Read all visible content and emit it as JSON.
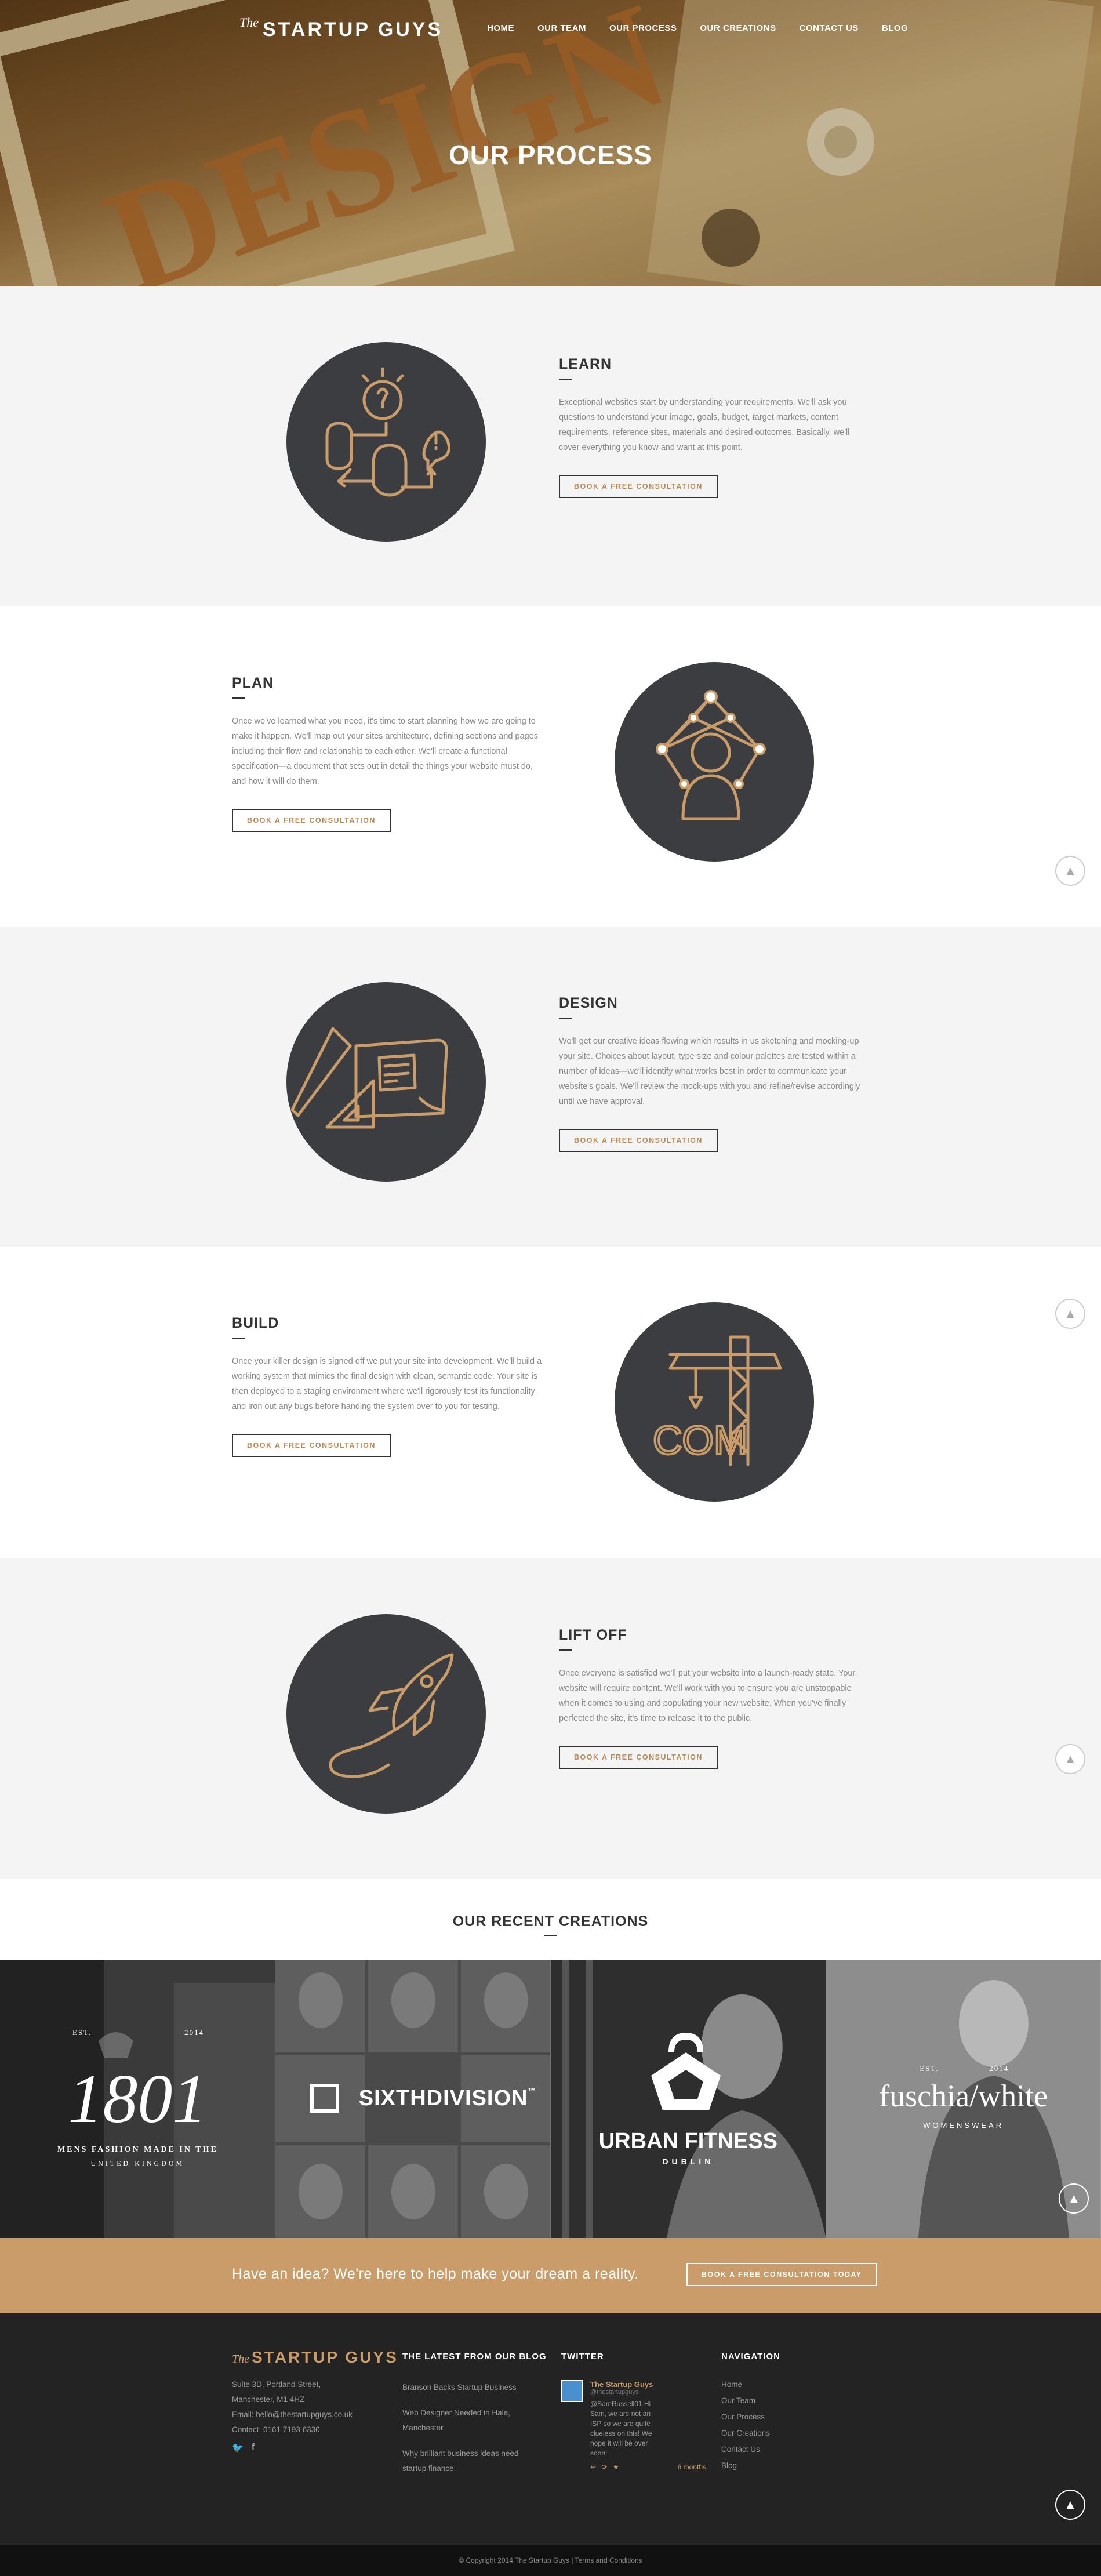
{
  "nav": {
    "logo_the": "The",
    "logo_name": "STARTUP GUYS",
    "items": [
      "HOME",
      "OUR TEAM",
      "OUR PROCESS",
      "OUR CREATIONS",
      "CONTACT US",
      "BLOG"
    ]
  },
  "hero": {
    "title": "OUR PROCESS",
    "image_text": "DESIGN"
  },
  "steps": [
    {
      "title": "LEARN",
      "body": "Exceptional websites start by understanding your requirements. We'll ask you questions to understand your image, goals, budget, target markets, content requirements, reference sites, materials and desired outcomes. Basically, we'll cover everything you know and want at this point.",
      "button": "BOOK A FREE CONSULTATION",
      "icon": "learn-icon"
    },
    {
      "title": "PLAN",
      "body": "Once we've learned what you need, it's time to start planning how we are going to make it happen. We'll map out your sites architecture, defining sections and pages including their flow and relationship to each other. We'll create a functional specification—a document that sets out in detail the things your website must do, and how it will do them.",
      "button": "BOOK A FREE CONSULTATION",
      "icon": "plan-icon"
    },
    {
      "title": "DESIGN",
      "body": "We'll get our creative ideas flowing which results in us sketching and mocking-up your site. Choices about layout, type size and colour palettes are tested within a number of ideas—we'll identify what works best in order to communicate your website's goals. We'll review the mock-ups with you and refine/revise accordingly until we have approval.",
      "button": "BOOK A FREE CONSULTATION",
      "icon": "design-icon"
    },
    {
      "title": "BUILD",
      "body": "Once your killer design is signed off we put your site into development. We'll build a working system that mimics the final design with clean, semantic code. Your site is then deployed to a staging environment where we'll rigorously test its functionality and iron out any bugs before handing the system over to you for testing.",
      "button": "BOOK A FREE CONSULTATION",
      "icon": "build-icon",
      "icon_text": "COM"
    },
    {
      "title": "LIFT OFF",
      "body": "Once everyone is satisfied we'll put your website into a launch-ready state. Your website will require content. We'll work with you to ensure you are unstoppable when it comes to using and populating your new website. When you've finally perfected the site, it's time to release it to the public.",
      "button": "BOOK A FREE CONSULTATION",
      "icon": "rocket-icon"
    }
  ],
  "creations": {
    "title": "OUR RECENT CREATIONS",
    "items": [
      {
        "brand": "1801",
        "sub": "MENS FASHION MADE IN THE",
        "sub2": "UNITED KINGDOM",
        "est": "EST.",
        "year": "2014"
      },
      {
        "brand": "SIXTHDIVISION",
        "tm": "™"
      },
      {
        "brand": "URBAN FITNESS",
        "sub": "DUBLIN"
      },
      {
        "brand": "fuschia/white",
        "sub": "WOMENSWEAR",
        "est": "EST.",
        "year": "2014"
      }
    ]
  },
  "cta": {
    "text": "Have an idea? We're here to help make your dream a reality.",
    "button": "BOOK A FREE CONSULTATION TODAY"
  },
  "footer": {
    "logo_the": "The",
    "logo_name": "STARTUP GUYS",
    "address": [
      "Suite 3D, Portland Street,",
      "Manchester, M1 4HZ"
    ],
    "email": "Email: hello@thestartupguys.co.uk",
    "contact": "Contact: 0161 7193 6330",
    "blog_title": "THE LATEST FROM OUR BLOG",
    "blog_posts": [
      "Branson Backs Startup Business",
      "Web Designer Needed in Hale, Manchester",
      "Why brilliant business ideas need startup finance."
    ],
    "twitter_title": "TWITTER",
    "tweet_name": "The Startup Guys",
    "tweet_handle": "@thestartupguys",
    "tweet_text": "@SamRussell01 Hi Sam, we are not an ISP so we are quite clueless on this! We hope it will be over soon!",
    "tweet_time": "6 months",
    "nav_title": "NAVIGATION",
    "nav_links": [
      "Home",
      "Our Team",
      "Our Process",
      "Our Creations",
      "Contact Us",
      "Blog"
    ],
    "copyright": "© Copyright 2014 The Startup Guys | Terms and Conditions"
  },
  "colors": {
    "accent": "#c99c6a",
    "circle": "#3c3d40",
    "footer": "#232323",
    "section_gray": "#f4f4f4"
  }
}
